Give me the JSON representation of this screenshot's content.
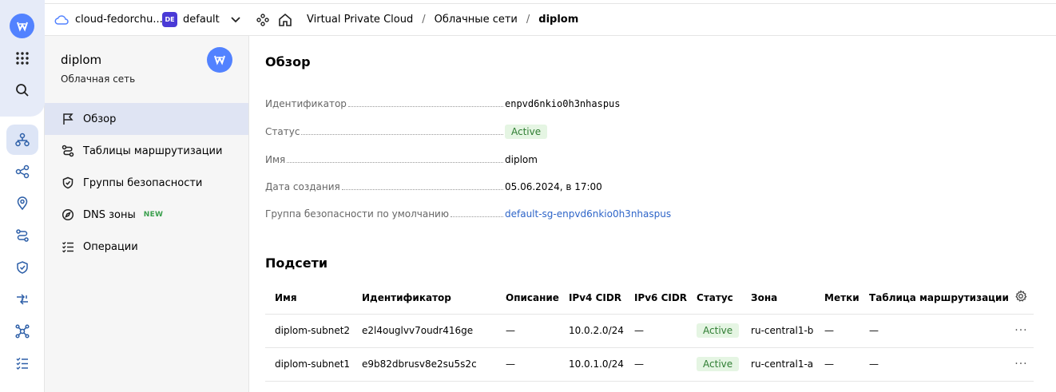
{
  "topbar": {
    "cloud_name": "cloud-fedorchu...",
    "folder_badge": "DE",
    "folder_name": "default",
    "breadcrumb": [
      "Virtual Private Cloud",
      "Облачные сети",
      "diplom"
    ],
    "separator": "/"
  },
  "sidebar": {
    "title": "diplom",
    "subtitle": "Облачная сеть",
    "items": [
      {
        "label": "Обзор",
        "icon": "flag-icon",
        "active": true
      },
      {
        "label": "Таблицы маршрутизации",
        "icon": "route-icon"
      },
      {
        "label": "Группы безопасности",
        "icon": "shield-icon"
      },
      {
        "label": "DNS зоны",
        "icon": "compass-icon",
        "badge": "NEW"
      },
      {
        "label": "Операции",
        "icon": "list-icon"
      }
    ]
  },
  "overview": {
    "title": "Обзор",
    "props": [
      {
        "label": "Идентификатор",
        "value": "enpvd6nkio0h3nhaspus",
        "kind": "mono"
      },
      {
        "label": "Статус",
        "value": "Active",
        "kind": "badge"
      },
      {
        "label": "Имя",
        "value": "diplom",
        "kind": "text"
      },
      {
        "label": "Дата создания",
        "value": "05.06.2024, в 17:00",
        "kind": "text"
      },
      {
        "label": "Группа безопасности по умолчанию",
        "value": "default-sg-enpvd6nkio0h3nhaspus",
        "kind": "link"
      }
    ]
  },
  "subnets": {
    "title": "Подсети",
    "columns": [
      "Имя",
      "Идентификатор",
      "Описание",
      "IPv4 CIDR",
      "IPv6 CIDR",
      "Статус",
      "Зона",
      "Метки",
      "Таблица маршрутизации"
    ],
    "rows": [
      [
        "diplom-subnet2",
        "e2l4ouglvv7oudr416ge",
        "—",
        "10.0.2.0/24",
        "—",
        "Active",
        "ru-central1-b",
        "—",
        "—"
      ],
      [
        "diplom-subnet1",
        "e9b82dbrusv8e2su5s2c",
        "—",
        "10.0.1.0/24",
        "—",
        "Active",
        "ru-central1-a",
        "—",
        "—"
      ]
    ],
    "row_menu": "···"
  },
  "colors": {
    "accent": "#5282ff",
    "active_bg": "#dfe4f3",
    "status_bg": "#e5f5e3",
    "status_fg": "#2e7d32",
    "link": "#2d64c8"
  }
}
